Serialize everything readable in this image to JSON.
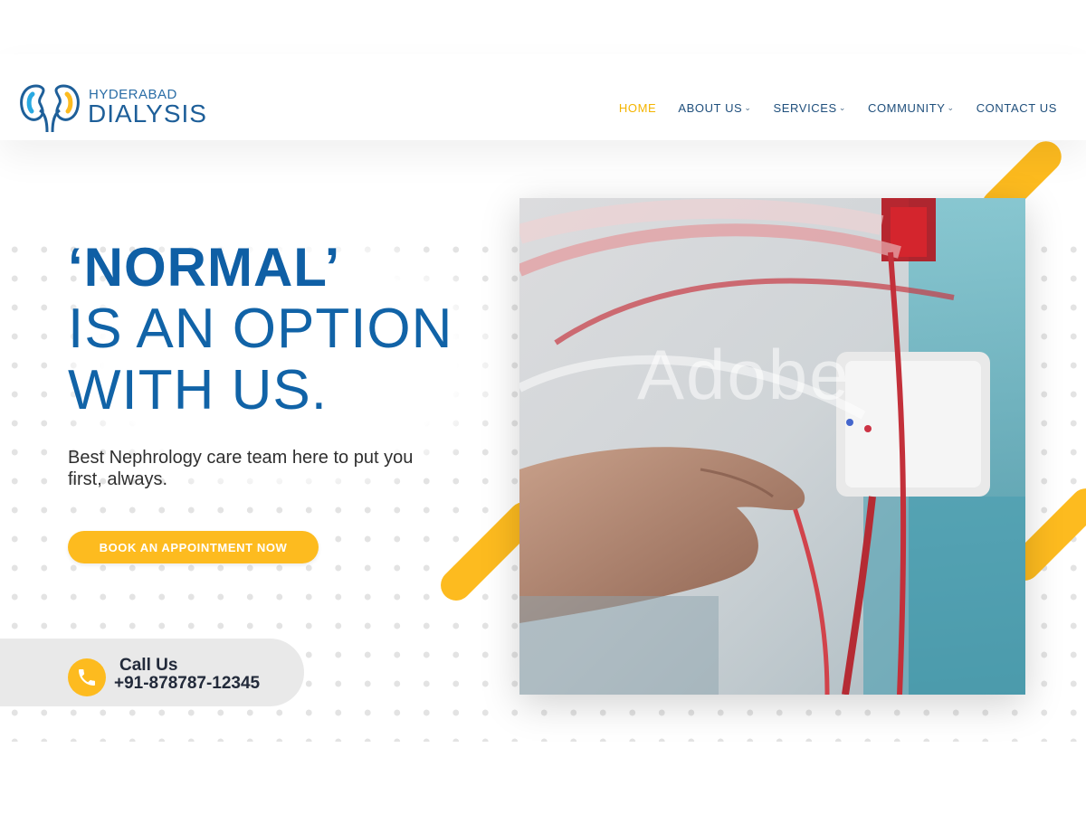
{
  "brand": {
    "name_top": "HYDERABAD",
    "name_bottom": "DIALYSIS",
    "primary_color": "#1e5f99",
    "accent_color": "#fdbb1f"
  },
  "nav": {
    "items": [
      {
        "label": "HOME",
        "active": true,
        "dropdown": false
      },
      {
        "label": "ABOUT US",
        "active": false,
        "dropdown": true
      },
      {
        "label": "SERVICES",
        "active": false,
        "dropdown": true
      },
      {
        "label": "COMMUNITY",
        "active": false,
        "dropdown": true
      },
      {
        "label": "CONTACT US",
        "active": false,
        "dropdown": false
      }
    ]
  },
  "hero": {
    "title_line1": "‘NORMAL’",
    "title_line2": "IS AN OPTION",
    "title_line3": "WITH US.",
    "subtitle": "Best Nephrology care team here to put you first, always.",
    "cta_label": "BOOK AN APPOINTMENT NOW",
    "image_watermark": "Adobe"
  },
  "call": {
    "label": "Call Us",
    "number": "+91-878787-12345",
    "icon": "phone-icon"
  }
}
